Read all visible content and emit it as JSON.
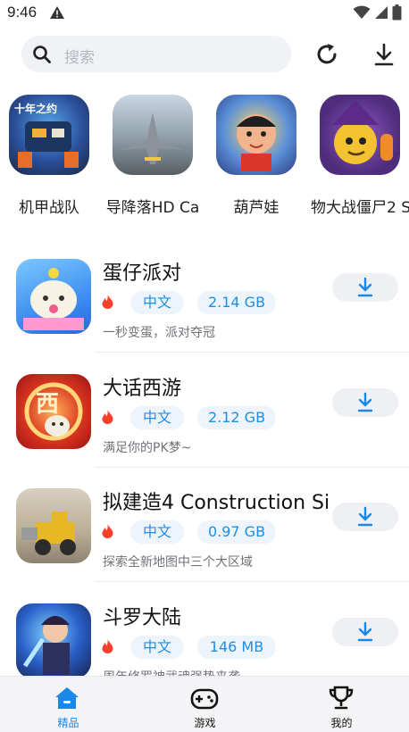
{
  "status_bar": {
    "time": "9:46"
  },
  "search": {
    "placeholder": "搜索"
  },
  "carousel": [
    {
      "label": "机甲战队"
    },
    {
      "label": "导降落HD Ca"
    },
    {
      "label": "葫芦娃"
    },
    {
      "label": "物大战僵尸2 S"
    }
  ],
  "apps": [
    {
      "title": "蛋仔派对",
      "language": "中文",
      "size": "2.14 GB",
      "description": "一秒变蛋，派对夺冠"
    },
    {
      "title": "大话西游",
      "language": "中文",
      "size": "2.12 GB",
      "description": "满足你的PK梦~"
    },
    {
      "title": "拟建造4 Construction Si",
      "language": "中文",
      "size": "0.97 GB",
      "description": "探索全新地图中三个大区域"
    },
    {
      "title": "斗罗大陆",
      "language": "中文",
      "size": "146 MB",
      "description": "周年修罗神武魂强势来袭"
    }
  ],
  "tabs": [
    {
      "label": "精品"
    },
    {
      "label": "游戏"
    },
    {
      "label": "我的"
    }
  ],
  "colors": {
    "accent": "#1b87e6",
    "fire": "#f5402c",
    "tag_bg": "#eef4fb"
  }
}
